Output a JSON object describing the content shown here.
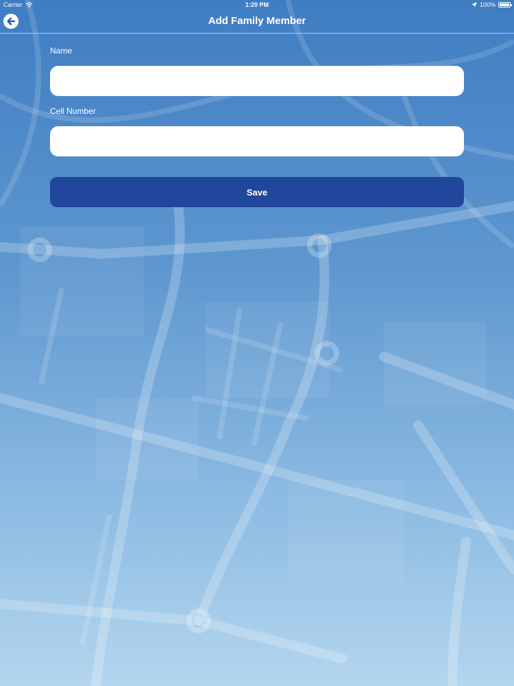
{
  "status_bar": {
    "carrier": "Carrier",
    "time": "1:20 PM",
    "battery": "100%",
    "battery_level": 1.0
  },
  "nav": {
    "title": "Add Family Member"
  },
  "form": {
    "name_label": "Name",
    "name_value": "",
    "phone_label": "Cell Number",
    "phone_value": "",
    "save_label": "Save"
  },
  "colors": {
    "primary_button": "#21479c",
    "background_top": "#3f7dc2",
    "background_bottom": "#b4d6ee"
  },
  "icons": {
    "back": "back-arrow-icon",
    "wifi": "wifi-icon",
    "location": "location-arrow-icon",
    "battery": "battery-icon"
  }
}
